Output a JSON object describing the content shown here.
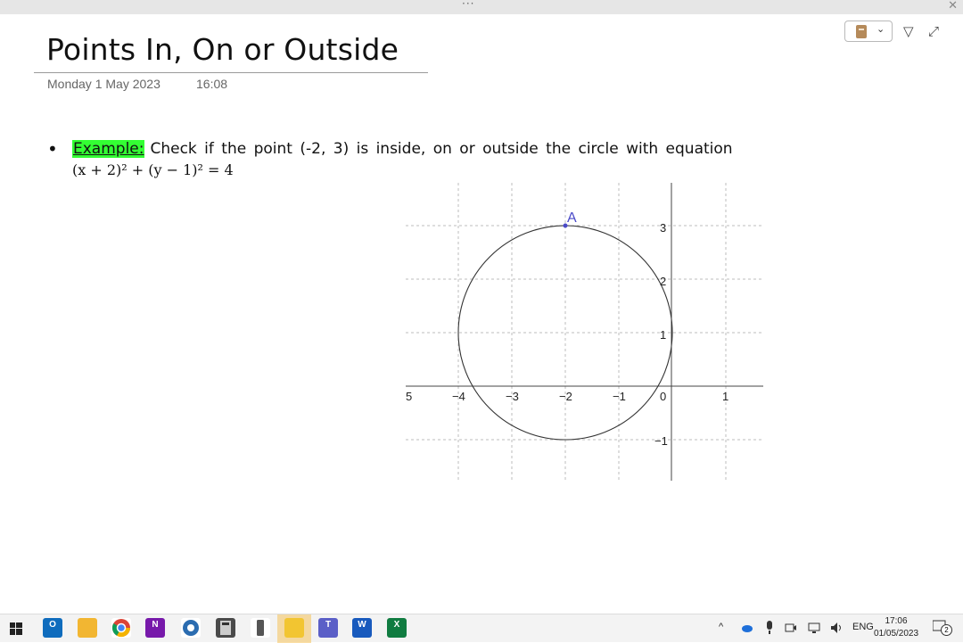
{
  "window": {
    "menu_dots": "···",
    "close_glyph": "✕"
  },
  "page": {
    "title": "Points In, On or Outside",
    "date": "Monday 1 May 2023",
    "time": "16:08"
  },
  "toolbar": {
    "notebook_icon": "notebook-icon",
    "dropdown_glyph": "⌄",
    "pen_glyph": "▽",
    "expand_glyph": "⤢"
  },
  "content": {
    "bullet": "•",
    "example_label": "Example:",
    "question": "Check if the point (-2, 3) is inside, on or outside the circle with equation",
    "equation": "(x + 2)² + (y − 1)² = 4"
  },
  "graph": {
    "x_tick_labels": [
      "5",
      "−4",
      "−3",
      "−2",
      "−1",
      "0",
      "1"
    ],
    "y_tick_labels": [
      "3",
      "2",
      "1",
      "−1"
    ],
    "point_label": "A",
    "circle": {
      "center": [
        -2,
        1
      ],
      "radius": 2
    },
    "point": [
      -2,
      3
    ],
    "xlim": [
      -5,
      1.7
    ],
    "ylim": [
      -1.75,
      3.8
    ],
    "grid": true,
    "colors": {
      "circle": "#333333",
      "point": "#4a4ac8",
      "grid": "#bdbdbd",
      "axis": "#444444"
    }
  },
  "taskbar": {
    "apps": [
      {
        "name": "Outlook",
        "letter": "O",
        "color": "#0f6cbd"
      },
      {
        "name": "File Explorer",
        "letter": "",
        "color": "#f2b632"
      },
      {
        "name": "Chrome",
        "letter": "",
        "color": "#db4437"
      },
      {
        "name": "OneNote",
        "letter": "N",
        "color": "#7719aa"
      },
      {
        "name": "Remote",
        "letter": "",
        "color": "#2b6cb0"
      },
      {
        "name": "Calculator",
        "letter": "",
        "color": "#4a4a4a"
      },
      {
        "name": "Phone",
        "letter": "",
        "color": "#555555"
      },
      {
        "name": "Sticky Notes",
        "letter": "",
        "color": "#f2c531"
      },
      {
        "name": "Teams",
        "letter": "T",
        "color": "#5b5fc7"
      },
      {
        "name": "Word",
        "letter": "W",
        "color": "#185abd"
      },
      {
        "name": "Excel",
        "letter": "X",
        "color": "#107c41"
      }
    ],
    "tray": {
      "chevron": "^",
      "language": "ENG",
      "clock_time": "17:06",
      "clock_date": "01/05/2023",
      "notification_count": "2"
    }
  }
}
